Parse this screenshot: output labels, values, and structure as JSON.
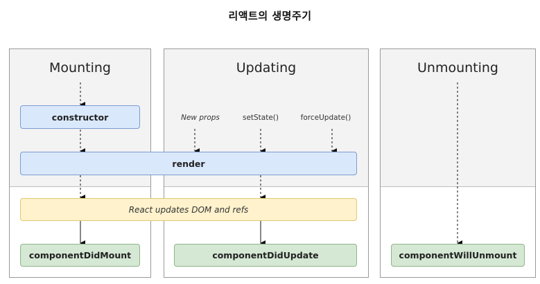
{
  "title": "리액트의 생명주기",
  "phases": {
    "mounting": "Mounting",
    "updating": "Updating",
    "unmounting": "Unmounting"
  },
  "boxes": {
    "constructor": "constructor",
    "render": "render",
    "dom_update": "React updates DOM and refs",
    "did_mount": "componentDidMount",
    "did_update": "componentDidUpdate",
    "will_unmount": "componentWillUnmount"
  },
  "triggers": {
    "new_props": "New props",
    "set_state": "setState()",
    "force_update": "forceUpdate()"
  }
}
